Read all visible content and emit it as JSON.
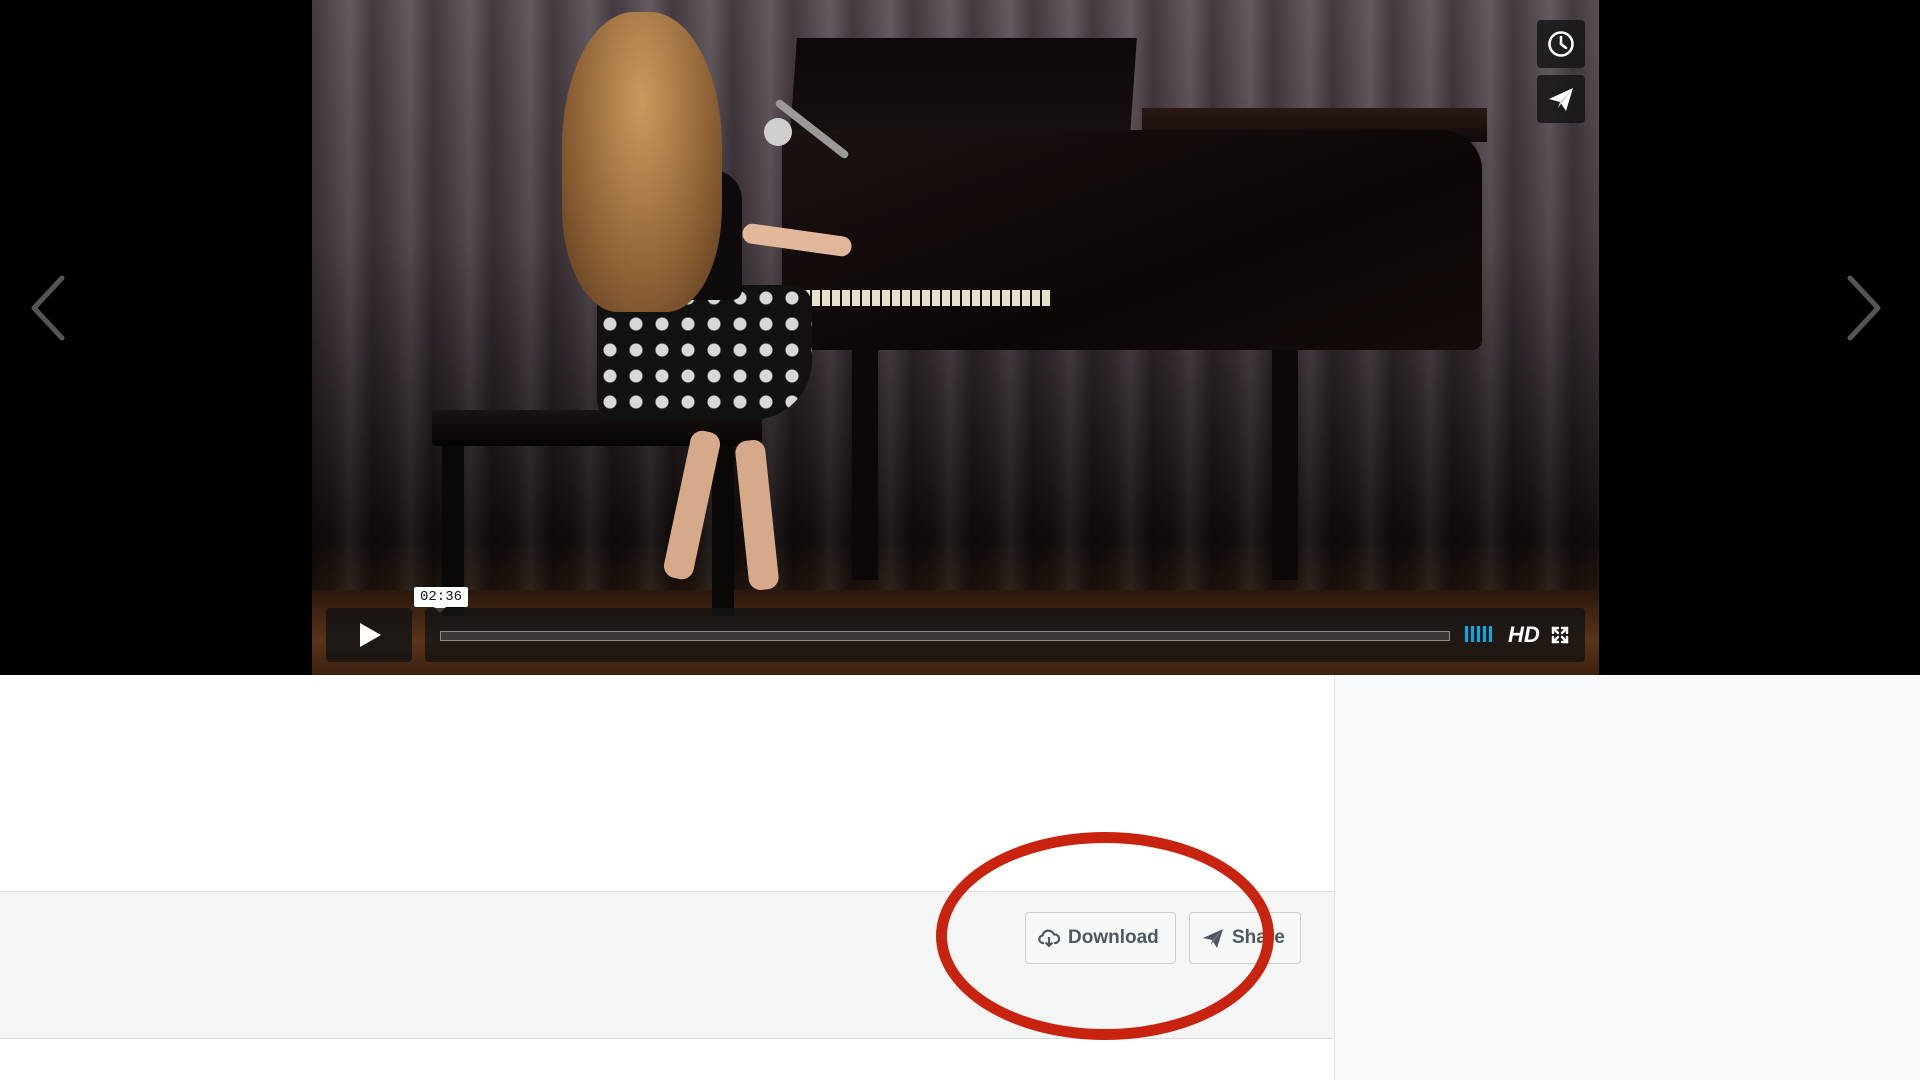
{
  "player": {
    "timestamp": "02:36",
    "hd_label": "HD",
    "progress_fraction": 0.0,
    "volume_bars": 5,
    "accent_color": "#00adef"
  },
  "actions": {
    "download_label": "Download",
    "share_label": "Share"
  },
  "annotation": {
    "ring_color": "#c8230f"
  }
}
